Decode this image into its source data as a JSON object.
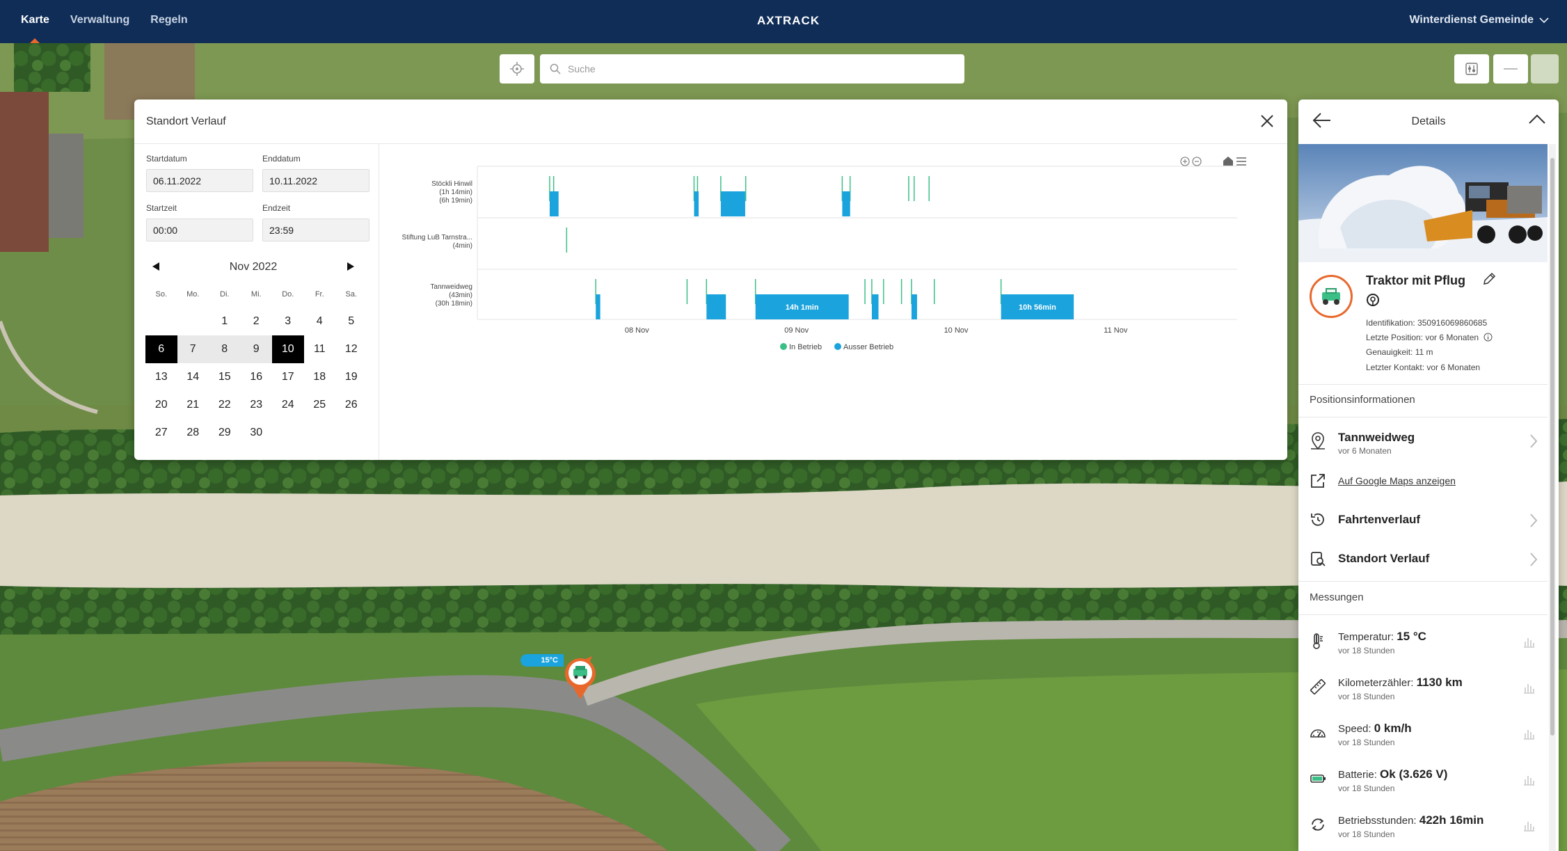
{
  "nav": {
    "items": [
      {
        "label": "Karte"
      },
      {
        "label": "Verwaltung"
      },
      {
        "label": "Regeln"
      }
    ],
    "logo": "AXTRACK",
    "account": "Winterdienst Gemeinde"
  },
  "search": {
    "placeholder": "Suche"
  },
  "map": {
    "marker_temp": "15°C"
  },
  "history": {
    "title": "Standort Verlauf",
    "start_date_label": "Startdatum",
    "start_date": "06.11.2022",
    "end_date_label": "Enddatum",
    "end_date": "10.11.2022",
    "start_time_label": "Startzeit",
    "start_time": "00:00",
    "end_time_label": "Endzeit",
    "end_time": "23:59",
    "calendar": {
      "month": "Nov 2022",
      "weekdays": [
        "So.",
        "Mo.",
        "Di.",
        "Mi.",
        "Do.",
        "Fr.",
        "Sa."
      ],
      "days": [
        "",
        "",
        "1",
        "2",
        "3",
        "4",
        "5",
        "6",
        "7",
        "8",
        "9",
        "10",
        "11",
        "12",
        "13",
        "14",
        "15",
        "16",
        "17",
        "18",
        "19",
        "20",
        "21",
        "22",
        "23",
        "24",
        "25",
        "26",
        "27",
        "28",
        "29",
        "30"
      ],
      "selected_start": 6,
      "selected_end": 10
    }
  },
  "chart_data": {
    "type": "timeline",
    "rows": [
      {
        "name": "Stöckli Hinwil",
        "sub1": "(1h 14min)",
        "sub2": "(6h 19min)"
      },
      {
        "name": "Stiftung LuB Tarnstra...",
        "sub1": "(4min)",
        "sub2": ""
      },
      {
        "name": "Tannweidweg",
        "sub1": "(43min)",
        "sub2": "(30h 18min)"
      }
    ],
    "x_range": [
      "2022-11-07T00:00",
      "2022-11-11T12:00"
    ],
    "x_ticks": [
      {
        "date": "2022-11-08T00:00",
        "label": "08 Nov"
      },
      {
        "date": "2022-11-09T00:00",
        "label": "09 Nov"
      },
      {
        "date": "2022-11-10T00:00",
        "label": "10 Nov"
      },
      {
        "date": "2022-11-11T00:00",
        "label": "11 Nov"
      }
    ],
    "legend": [
      {
        "label": "In Betrieb",
        "color": "#3cbf86"
      },
      {
        "label": "Ausser Betrieb",
        "color": "#1aa3dc"
      }
    ],
    "segments": [
      {
        "row": 0,
        "kind": "in",
        "start": "2022-11-07T10:48",
        "end": "2022-11-07T10:53"
      },
      {
        "row": 0,
        "kind": "in",
        "start": "2022-11-07T11:24",
        "end": "2022-11-07T11:29"
      },
      {
        "row": 0,
        "kind": "out",
        "start": "2022-11-07T10:53",
        "end": "2022-11-07T12:13"
      },
      {
        "row": 0,
        "kind": "in",
        "start": "2022-11-08T08:31",
        "end": "2022-11-08T08:36"
      },
      {
        "row": 0,
        "kind": "in",
        "start": "2022-11-08T09:02",
        "end": "2022-11-08T09:07"
      },
      {
        "row": 0,
        "kind": "out",
        "start": "2022-11-08T08:36",
        "end": "2022-11-08T09:17"
      },
      {
        "row": 0,
        "kind": "in",
        "start": "2022-11-08T12:32",
        "end": "2022-11-08T12:37"
      },
      {
        "row": 0,
        "kind": "in",
        "start": "2022-11-08T16:17",
        "end": "2022-11-08T16:22"
      },
      {
        "row": 0,
        "kind": "out",
        "start": "2022-11-08T12:37",
        "end": "2022-11-08T16:17"
      },
      {
        "row": 0,
        "kind": "in",
        "start": "2022-11-09T06:48",
        "end": "2022-11-09T06:53"
      },
      {
        "row": 0,
        "kind": "in",
        "start": "2022-11-09T07:59",
        "end": "2022-11-09T08:04"
      },
      {
        "row": 0,
        "kind": "out",
        "start": "2022-11-09T06:53",
        "end": "2022-11-09T08:04"
      },
      {
        "row": 0,
        "kind": "in",
        "start": "2022-11-09T16:48",
        "end": "2022-11-09T16:53"
      },
      {
        "row": 0,
        "kind": "in",
        "start": "2022-11-09T17:37",
        "end": "2022-11-09T17:42"
      },
      {
        "row": 0,
        "kind": "in",
        "start": "2022-11-09T19:52",
        "end": "2022-11-09T19:57"
      },
      {
        "row": 1,
        "kind": "in",
        "start": "2022-11-07T13:21",
        "end": "2022-11-07T13:25"
      },
      {
        "row": 2,
        "kind": "in",
        "start": "2022-11-07T17:44",
        "end": "2022-11-07T17:49"
      },
      {
        "row": 2,
        "kind": "out",
        "start": "2022-11-07T17:49",
        "end": "2022-11-07T18:29"
      },
      {
        "row": 2,
        "kind": "in",
        "start": "2022-11-08T07:28",
        "end": "2022-11-08T07:33"
      },
      {
        "row": 2,
        "kind": "in",
        "start": "2022-11-08T10:23",
        "end": "2022-11-08T10:28"
      },
      {
        "row": 2,
        "kind": "out",
        "start": "2022-11-08T10:28",
        "end": "2022-11-08T13:23"
      },
      {
        "row": 2,
        "kind": "in",
        "start": "2022-11-08T17:45",
        "end": "2022-11-08T17:50"
      },
      {
        "row": 2,
        "kind": "out",
        "start": "2022-11-08T17:50",
        "end": "2022-11-09T07:51",
        "label": "14h 1min"
      },
      {
        "row": 2,
        "kind": "in",
        "start": "2022-11-09T10:13",
        "end": "2022-11-09T10:18"
      },
      {
        "row": 2,
        "kind": "in",
        "start": "2022-11-09T11:15",
        "end": "2022-11-09T11:20"
      },
      {
        "row": 2,
        "kind": "out",
        "start": "2022-11-09T11:20",
        "end": "2022-11-09T12:20"
      },
      {
        "row": 2,
        "kind": "in",
        "start": "2022-11-09T13:01",
        "end": "2022-11-09T13:06"
      },
      {
        "row": 2,
        "kind": "in",
        "start": "2022-11-09T15:43",
        "end": "2022-11-09T15:48"
      },
      {
        "row": 2,
        "kind": "in",
        "start": "2022-11-09T17:13",
        "end": "2022-11-09T17:18"
      },
      {
        "row": 2,
        "kind": "out",
        "start": "2022-11-09T17:18",
        "end": "2022-11-09T18:08"
      },
      {
        "row": 2,
        "kind": "in",
        "start": "2022-11-09T20:39",
        "end": "2022-11-09T20:44"
      },
      {
        "row": 2,
        "kind": "in",
        "start": "2022-11-10T06:41",
        "end": "2022-11-10T06:46"
      },
      {
        "row": 2,
        "kind": "out",
        "start": "2022-11-10T06:46",
        "end": "2022-11-10T17:42",
        "label": "10h 56min"
      }
    ]
  },
  "details": {
    "title": "Details",
    "vehicle_name": "Traktor mit Pflug",
    "identification": "Identifikation: 350916069860685",
    "last_position": "Letzte Position: vor 6 Monaten",
    "accuracy": "Genauigkeit: 11 m",
    "last_contact": "Letzter Kontakt: vor 6 Monaten",
    "position_section": "Positionsinformationen",
    "location_name": "Tannweidweg",
    "location_time": "vor 6 Monaten",
    "google_maps": "Auf Google Maps anzeigen",
    "trip_history": "Fahrtenverlauf",
    "location_history": "Standort Verlauf",
    "measurements_section": "Messungen",
    "measurements": [
      {
        "label": "Temperatur:",
        "value": "15 °C",
        "time": "vor 18 Stunden",
        "icon": "thermometer-icon"
      },
      {
        "label": "Kilometerzähler:",
        "value": "1130 km",
        "time": "vor 18 Stunden",
        "icon": "ruler-icon"
      },
      {
        "label": "Speed:",
        "value": "0 km/h",
        "time": "vor 18 Stunden",
        "icon": "speedometer-icon"
      },
      {
        "label": "Batterie:",
        "value": "Ok (3.626 V)",
        "time": "vor 18 Stunden",
        "icon": "battery-icon"
      },
      {
        "label": "Betriebsstunden:",
        "value": "422h 16min",
        "time": "vor 18 Stunden",
        "icon": "hours-icon"
      }
    ]
  }
}
